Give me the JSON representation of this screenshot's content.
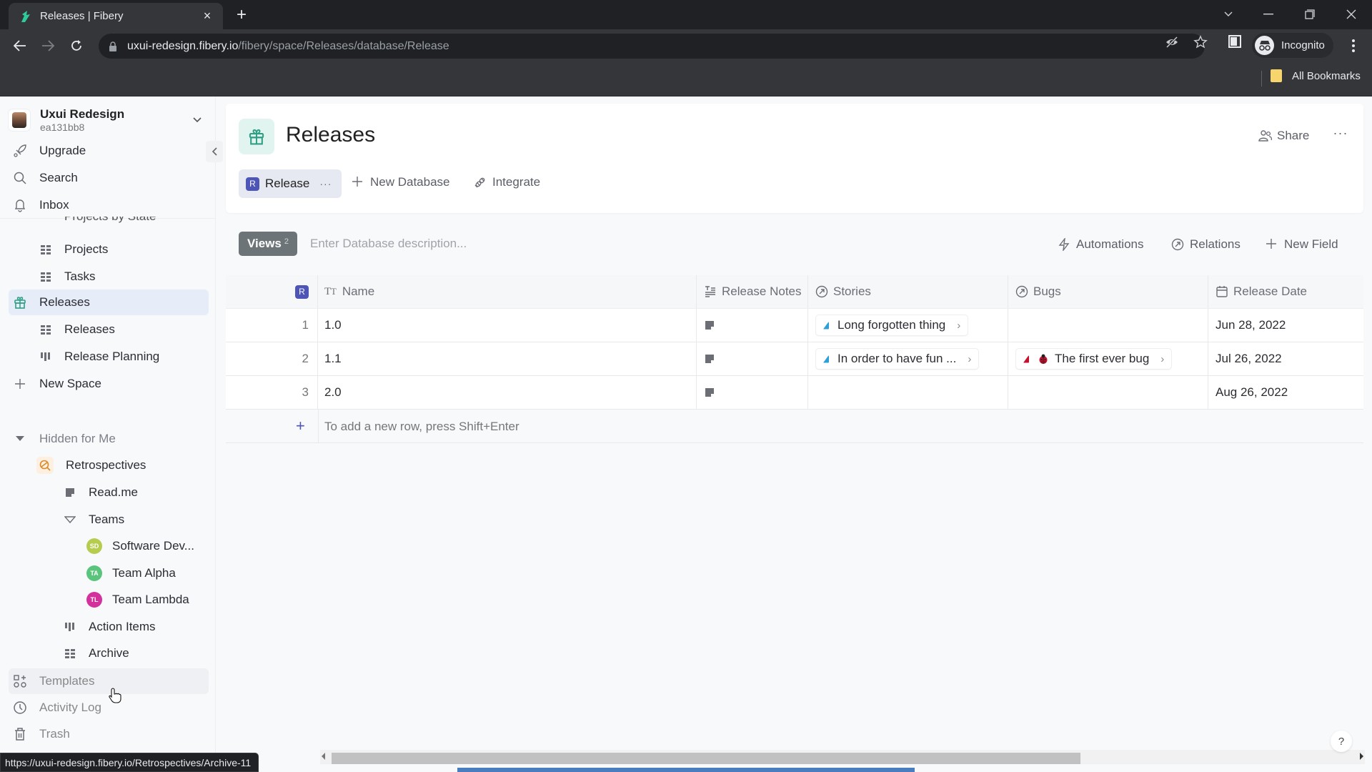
{
  "browser": {
    "tab_title": "Releases | Fibery",
    "url_host": "uxui-redesign.fibery.io",
    "url_path": "/fibery/space/Releases/database/Release",
    "profile_label": "Incognito",
    "bookmarks_folder": "All Bookmarks",
    "status_url": "https://uxui-redesign.fibery.io/Retrospectives/Archive-11"
  },
  "workspace": {
    "name": "Uxui Redesign",
    "id": "ea131bb8"
  },
  "sidebar": {
    "top_items": [
      {
        "label": "Upgrade",
        "icon": "rocket-icon"
      },
      {
        "label": "Search",
        "icon": "search-icon"
      },
      {
        "label": "Inbox",
        "icon": "bell-icon"
      }
    ],
    "cut_off_item": "Projects by State",
    "tree": [
      {
        "label": "Projects",
        "icon": "grid-icon"
      },
      {
        "label": "Tasks",
        "icon": "grid-icon"
      },
      {
        "label": "Releases",
        "icon": "gift-icon",
        "selected": true
      },
      {
        "label": "Releases",
        "icon": "grid-icon"
      },
      {
        "label": "Release Planning",
        "icon": "board-icon"
      },
      {
        "label": "New Space",
        "icon": "plus-icon"
      }
    ],
    "hidden_section": {
      "label": "Hidden for Me",
      "items": [
        {
          "label": "Retrospectives",
          "icon": "retro-icon"
        },
        {
          "label": "Read.me",
          "icon": "document-icon"
        },
        {
          "label": "Teams",
          "icon": "triangle-down-icon"
        },
        {
          "label": "Software Dev...",
          "initials": "SD",
          "color": "#b6cc4f"
        },
        {
          "label": "Team Alpha",
          "initials": "TA",
          "color": "#5bc47c"
        },
        {
          "label": "Team Lambda",
          "initials": "TL",
          "color": "#d3329c"
        },
        {
          "label": "Action Items",
          "icon": "board-icon"
        },
        {
          "label": "Archive",
          "icon": "grid-icon"
        }
      ]
    },
    "bottom_items": [
      {
        "label": "Templates",
        "icon": "templates-icon"
      },
      {
        "label": "Activity Log",
        "icon": "clock-icon"
      },
      {
        "label": "Trash",
        "icon": "trash-icon"
      }
    ]
  },
  "header": {
    "title": "Releases",
    "share_label": "Share",
    "more_label": "···",
    "db_tab": {
      "badge": "R",
      "label": "Release",
      "dots": "···"
    },
    "new_database_label": "New Database",
    "integrate_label": "Integrate"
  },
  "views_bar": {
    "views_label": "Views",
    "views_count": "2",
    "description_placeholder": "Enter Database description...",
    "automations_label": "Automations",
    "relations_label": "Relations",
    "new_field_label": "New Field"
  },
  "table": {
    "id_badge": "R",
    "columns": [
      "Name",
      "Release Notes",
      "Stories",
      "Bugs",
      "Release Date"
    ],
    "rows": [
      {
        "num": "1",
        "name": "1.0",
        "story": "Long forgotten thing",
        "bug": "",
        "date": "Jun 28, 2022"
      },
      {
        "num": "2",
        "name": "1.1",
        "story": "In order to have fun ...",
        "bug": "The first ever bug",
        "date": "Jul 26, 2022"
      },
      {
        "num": "3",
        "name": "2.0",
        "story": "",
        "bug": "",
        "date": "Aug 26, 2022"
      }
    ],
    "add_row_hint": "To add a new row, press Shift+Enter",
    "story_color": "#2f9fd8",
    "bug_color": "#c8102e"
  },
  "help_label": "?",
  "colors": {
    "accent": "#4d55b6",
    "teal": "#2e9f84",
    "selected_bg": "#e6ecf8"
  }
}
